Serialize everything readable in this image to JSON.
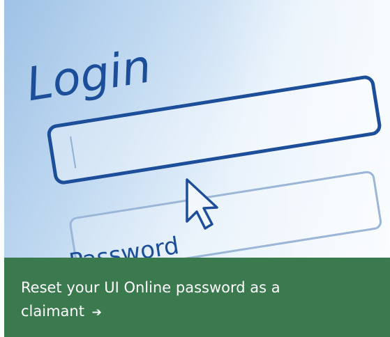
{
  "hero": {
    "heading_text": "Login",
    "password_label": "Password",
    "accent_color": "#1d4e9a"
  },
  "banner": {
    "link_text": "Reset your UI Online password as a claimant",
    "arrow_glyph": "➔",
    "background_color": "#3b7a4e"
  }
}
